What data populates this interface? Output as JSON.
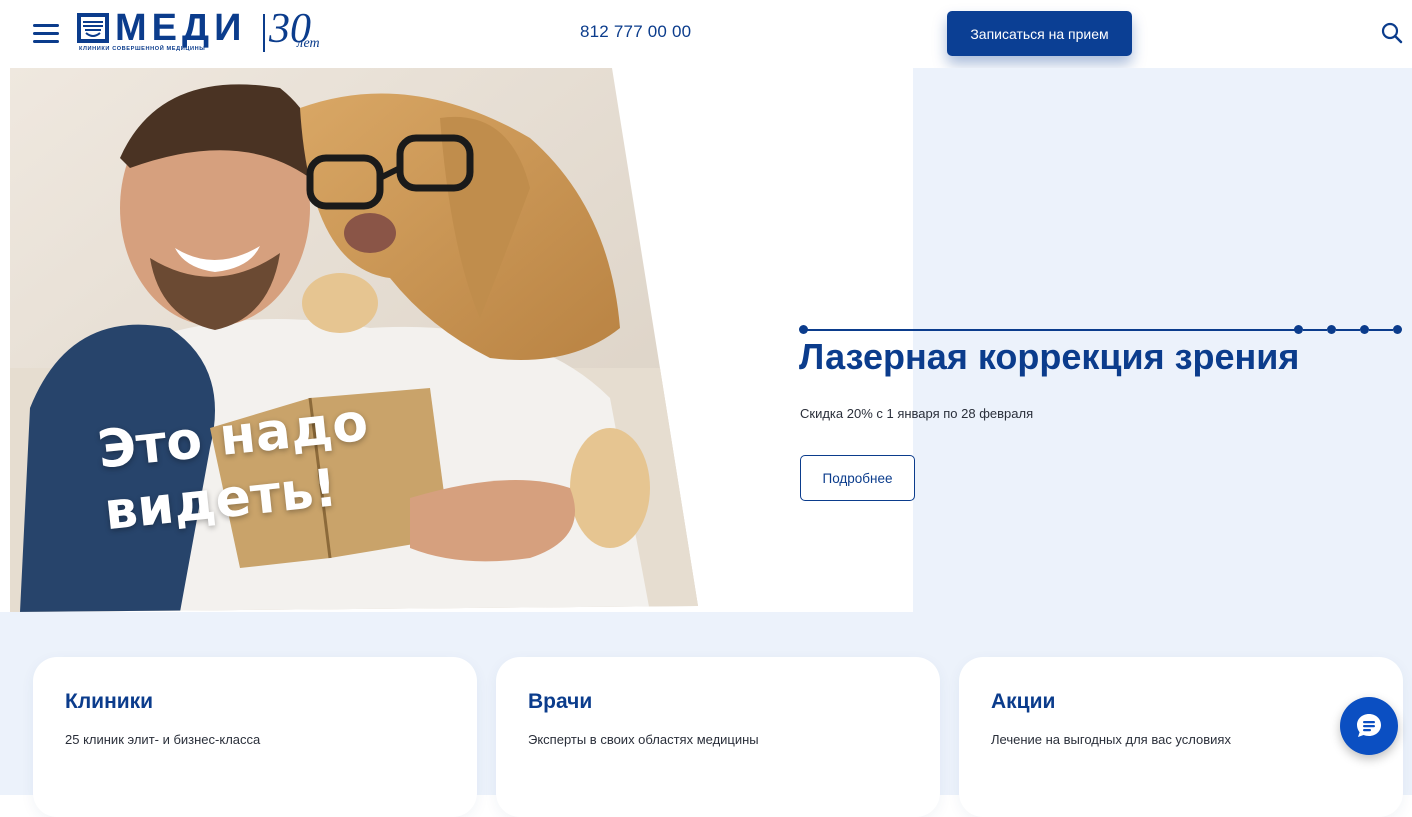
{
  "header": {
    "logo_word": "МЕДИ",
    "logo_tagline": "КЛИНИКИ СОВЕРШЕННОЙ МЕДИЦИНЫ",
    "logo_anniversary": "30",
    "logo_anniversary_suffix": "лет",
    "phone": "812 777 00 00",
    "cta_label": "Записаться на прием",
    "icons": {
      "menu": "hamburger-menu-icon",
      "search": "search-icon"
    }
  },
  "hero": {
    "caption_line1": "Это надо",
    "caption_line2": "видеть!",
    "title": "Лазерная коррекция зрения",
    "subtitle": "Скидка 20% с 1 января по 28 февраля",
    "button_label": "Подробнее",
    "slides_count": 4,
    "active_slide": 1
  },
  "cards": [
    {
      "title": "Клиники",
      "description": "25 клиник элит- и бизнес-класса"
    },
    {
      "title": "Врачи",
      "description": "Эксперты в своих областях медицины"
    },
    {
      "title": "Акции",
      "description": "Лечение на выгодных для вас условиях"
    }
  ],
  "colors": {
    "brand": "#0b3c8c",
    "cta": "#0b3f94",
    "light_bg": "#ecf2fb",
    "chat": "#0b4fc2"
  },
  "chat": {
    "icon": "chat-bubble-icon"
  }
}
